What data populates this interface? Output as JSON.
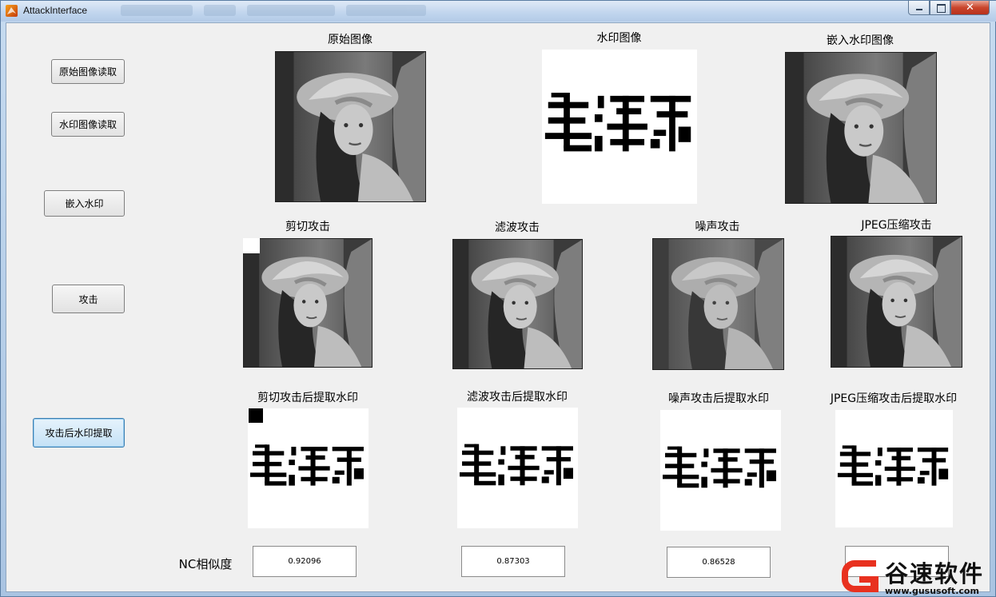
{
  "window": {
    "title": "AttackInterface",
    "close_glyph": "✕"
  },
  "buttons": {
    "read_original": "原始图像读取",
    "read_watermark": "水印图像读取",
    "embed": "嵌入水印",
    "attack": "攻击",
    "extract_after_attack": "攻击后水印提取"
  },
  "panels": {
    "original": "原始图像",
    "watermark": "水印图像",
    "embedded": "嵌入水印图像",
    "crop_attack": "剪切攻击",
    "filter_attack": "滤波攻击",
    "noise_attack": "噪声攻击",
    "jpeg_attack": "JPEG压缩攻击",
    "crop_extract": "剪切攻击后提取水印",
    "filter_extract": "滤波攻击后提取水印",
    "noise_extract": "噪声攻击后提取水印",
    "jpeg_extract": "JPEG压缩攻击后提取水印"
  },
  "nc": {
    "label": "NC相似度",
    "crop": "0.92096",
    "filter": "0.87303",
    "noise": "0.86528",
    "jpeg": ""
  },
  "watermark_text": "毛泽东",
  "brand": {
    "name": "谷速软件",
    "url": "www.gususoft.com",
    "accent": "#e8311f"
  }
}
